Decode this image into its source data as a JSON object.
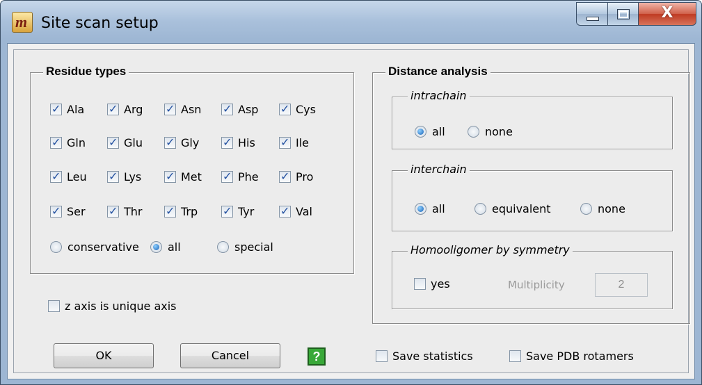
{
  "window": {
    "title": "Site scan setup",
    "app_icon": "molecule-m-icon",
    "controls": {
      "minimize": "minimize-icon",
      "maximize": "maximize-icon",
      "close": "X"
    }
  },
  "residue_types": {
    "title": "Residue types",
    "items": [
      {
        "label": "Ala",
        "checked": true
      },
      {
        "label": "Arg",
        "checked": true
      },
      {
        "label": "Asn",
        "checked": true
      },
      {
        "label": "Asp",
        "checked": true
      },
      {
        "label": "Cys",
        "checked": true
      },
      {
        "label": "Gln",
        "checked": true
      },
      {
        "label": "Glu",
        "checked": true
      },
      {
        "label": "Gly",
        "checked": true
      },
      {
        "label": "His",
        "checked": true
      },
      {
        "label": "Ile",
        "checked": true
      },
      {
        "label": "Leu",
        "checked": true
      },
      {
        "label": "Lys",
        "checked": true
      },
      {
        "label": "Met",
        "checked": true
      },
      {
        "label": "Phe",
        "checked": true
      },
      {
        "label": "Pro",
        "checked": true
      },
      {
        "label": "Ser",
        "checked": true
      },
      {
        "label": "Thr",
        "checked": true
      },
      {
        "label": "Trp",
        "checked": true
      },
      {
        "label": "Tyr",
        "checked": true
      },
      {
        "label": "Val",
        "checked": true
      }
    ],
    "modes": [
      {
        "label": "conservative",
        "selected": false
      },
      {
        "label": "all",
        "selected": true
      },
      {
        "label": "special",
        "selected": false
      }
    ]
  },
  "z_axis": {
    "label": "z axis is unique axis",
    "checked": false
  },
  "distance_analysis": {
    "title": "Distance analysis",
    "intrachain": {
      "title": "intrachain",
      "options": [
        {
          "label": "all",
          "selected": true
        },
        {
          "label": "none",
          "selected": false
        }
      ]
    },
    "interchain": {
      "title": "interchain",
      "options": [
        {
          "label": "all",
          "selected": true
        },
        {
          "label": "equivalent",
          "selected": false
        },
        {
          "label": "none",
          "selected": false
        }
      ]
    },
    "homooligomer": {
      "title": "Homooligomer by symmetry",
      "yes": {
        "label": "yes",
        "checked": false
      },
      "multiplicity_label": "Multiplicity",
      "multiplicity_value": "2"
    }
  },
  "buttons": {
    "ok": "OK",
    "cancel": "Cancel",
    "help": "?"
  },
  "save_statistics": {
    "label": "Save statistics",
    "checked": false
  },
  "save_pdb_rotamers": {
    "label": "Save PDB rotamers",
    "checked": false
  }
}
